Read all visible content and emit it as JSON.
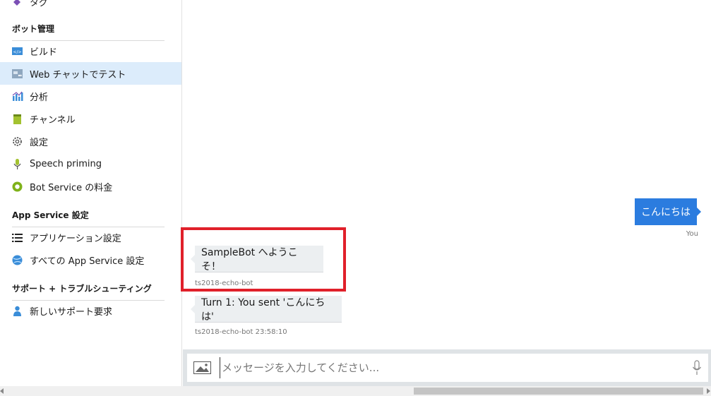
{
  "sidebar": {
    "top_partial": {
      "label": "タグ",
      "icon": "tag-icon"
    },
    "sections": [
      {
        "title": "ボット管理"
      },
      {
        "title": "App Service 設定"
      },
      {
        "title": "サポート + トラブルシューティング"
      }
    ],
    "items": [
      {
        "label": "ビルド",
        "icon": "code-icon"
      },
      {
        "label": "Web チャットでテスト",
        "icon": "chat-test-icon",
        "active": true
      },
      {
        "label": "分析",
        "icon": "analytics-icon"
      },
      {
        "label": "チャンネル",
        "icon": "channels-icon"
      },
      {
        "label": "設定",
        "icon": "gear-icon"
      },
      {
        "label": "Speech priming",
        "icon": "microphone-icon"
      },
      {
        "label": "Bot Service の料金",
        "icon": "pricing-icon"
      },
      {
        "label": "アプリケーション設定",
        "icon": "list-icon"
      },
      {
        "label": "すべての App Service 設定",
        "icon": "globe-icon"
      },
      {
        "label": "新しいサポート要求",
        "icon": "support-person-icon"
      }
    ]
  },
  "chat": {
    "user_message": {
      "text": "こんにちは",
      "sender": "You"
    },
    "bot_messages": [
      {
        "text": "SampleBot へようこそ！",
        "meta": "ts2018-echo-bot"
      },
      {
        "text": "Turn 1: You sent 'こんにちは'",
        "meta": "ts2018-echo-bot 23:58:10"
      }
    ],
    "input": {
      "placeholder": "メッセージを入力してください...",
      "value": ""
    },
    "colors": {
      "user_bubble": "#2b7cdf",
      "bot_bubble": "#eceff1",
      "highlight": "#e0202a"
    }
  }
}
